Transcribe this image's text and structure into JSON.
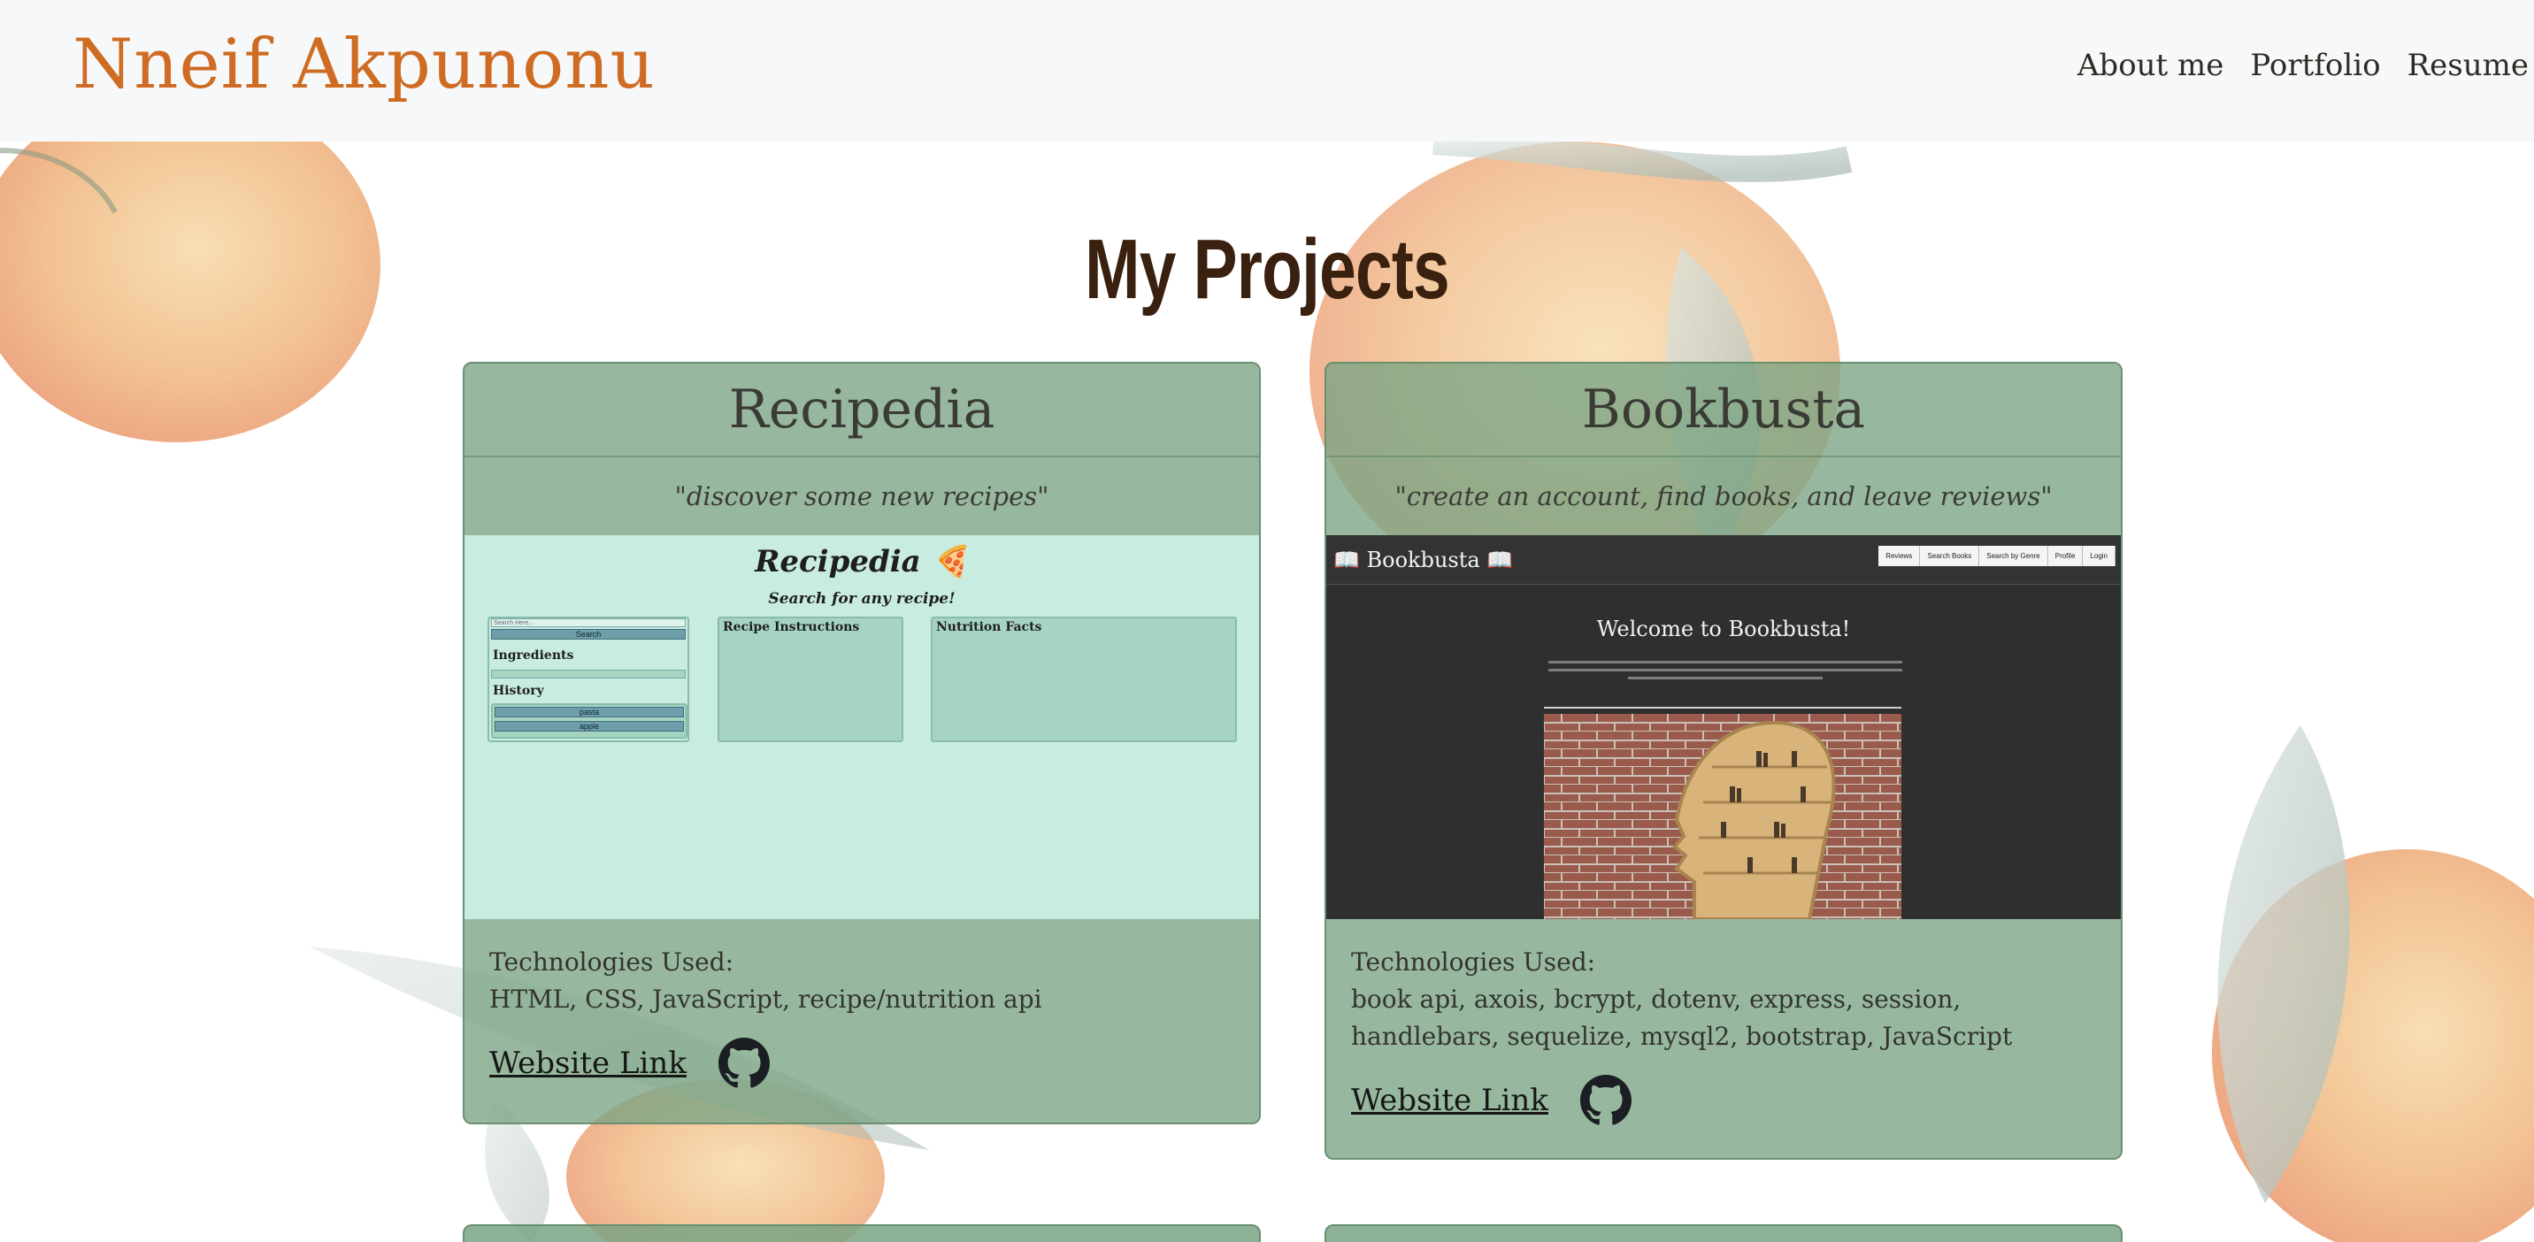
{
  "nav": {
    "brand": "Nneif Akpunonu",
    "links": [
      "About me",
      "Portfolio",
      "Resume"
    ]
  },
  "heading": "My Projects",
  "projects": [
    {
      "title": "Recipedia",
      "tagline": "\"discover some new recipes\"",
      "tech_label": "Technologies Used:",
      "tech": "HTML, CSS, JavaScript, recipe/nutrition api",
      "website_label": "Website Link",
      "preview": {
        "title": "Recipedia",
        "pizza": "🍕",
        "subtitle": "Search for any recipe!",
        "search_placeholder": "Search Here...",
        "search_button": "Search",
        "ingredients": "Ingredients",
        "history": "History",
        "history_items": [
          "pasta",
          "apple"
        ],
        "instructions": "Recipe Instructions",
        "nutrition": "Nutrition Facts"
      }
    },
    {
      "title": "Bookbusta",
      "tagline": "\"create an account, find books, and leave reviews\"",
      "tech_label": "Technologies Used:",
      "tech_line1": "book api, axois, bcrypt, dotenv, express, session,",
      "tech_line2": "handlebars, sequelize, mysql2, bootstrap, JavaScript",
      "website_label": "Website Link",
      "preview": {
        "brand": "📖 Bookbusta 📖",
        "menu": [
          "Reviews",
          "Search Books",
          "Search by Genre",
          "Profile",
          "Login"
        ],
        "welcome": "Welcome to Bookbusta!"
      }
    }
  ],
  "colors": {
    "brand": "#cf6b22",
    "heading": "#3a200f",
    "card": "#7aa484",
    "recipedia_bg": "#c8ece0",
    "bookbusta_bg": "#2f2f2f"
  },
  "icons": [
    "github-icon"
  ]
}
